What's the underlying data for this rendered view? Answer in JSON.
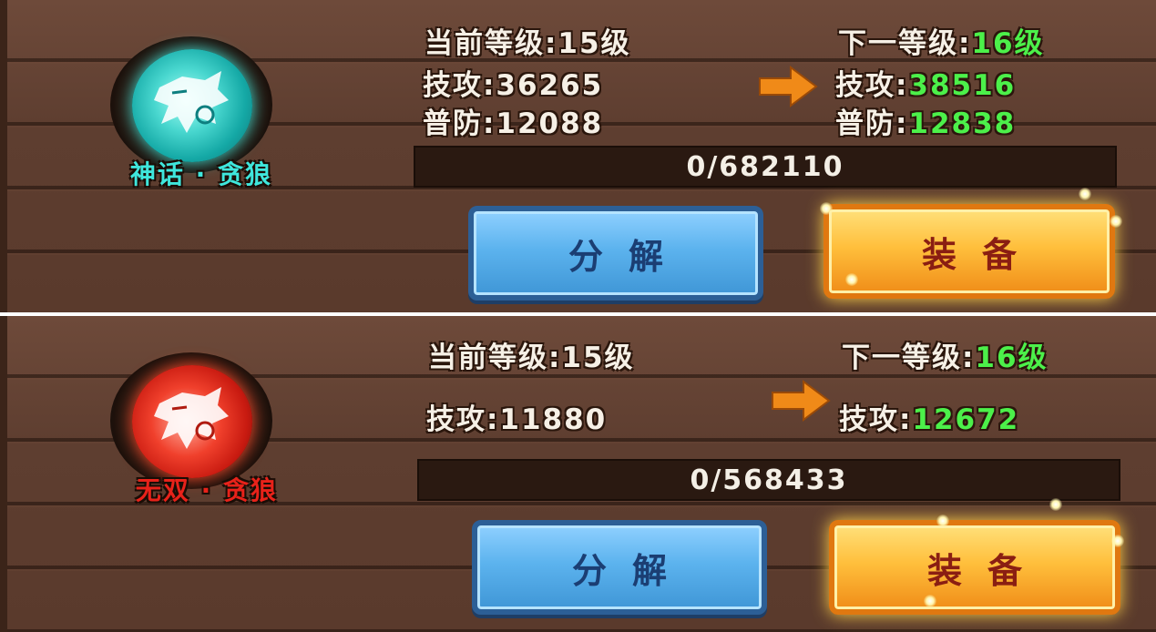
{
  "items": [
    {
      "name": "神话 · 贪狼",
      "name_color": "#3fe6dc",
      "current_level": "当前等级:15级",
      "next_level_label": "下一等级:",
      "next_level_value": "16级",
      "stats_current": [
        {
          "label": "技攻:",
          "value": "36265"
        },
        {
          "label": "普防:",
          "value": "12088"
        }
      ],
      "stats_next": [
        {
          "label": "技攻:",
          "value": "38516"
        },
        {
          "label": "普防:",
          "value": "12838"
        }
      ],
      "progress_text": "0/682110",
      "progress_fraction": 0,
      "decompose_label": "分解",
      "equip_label": "装备",
      "emblem_icon": "wolf-head-icon",
      "emblem_color": "teal"
    },
    {
      "name": "无双 · 贪狼",
      "name_color": "#e8221a",
      "current_level": "当前等级:15级",
      "next_level_label": "下一等级:",
      "next_level_value": "16级",
      "stats_current": [
        {
          "label": "技攻:",
          "value": "11880"
        }
      ],
      "stats_next": [
        {
          "label": "技攻:",
          "value": "12672"
        }
      ],
      "progress_text": "0/568433",
      "progress_fraction": 0,
      "decompose_label": "分解",
      "equip_label": "装备",
      "emblem_icon": "wolf-head-icon",
      "emblem_color": "red"
    }
  ],
  "colors": {
    "stat_green": "#4cf04a",
    "arrow_orange": "#f08a18"
  }
}
